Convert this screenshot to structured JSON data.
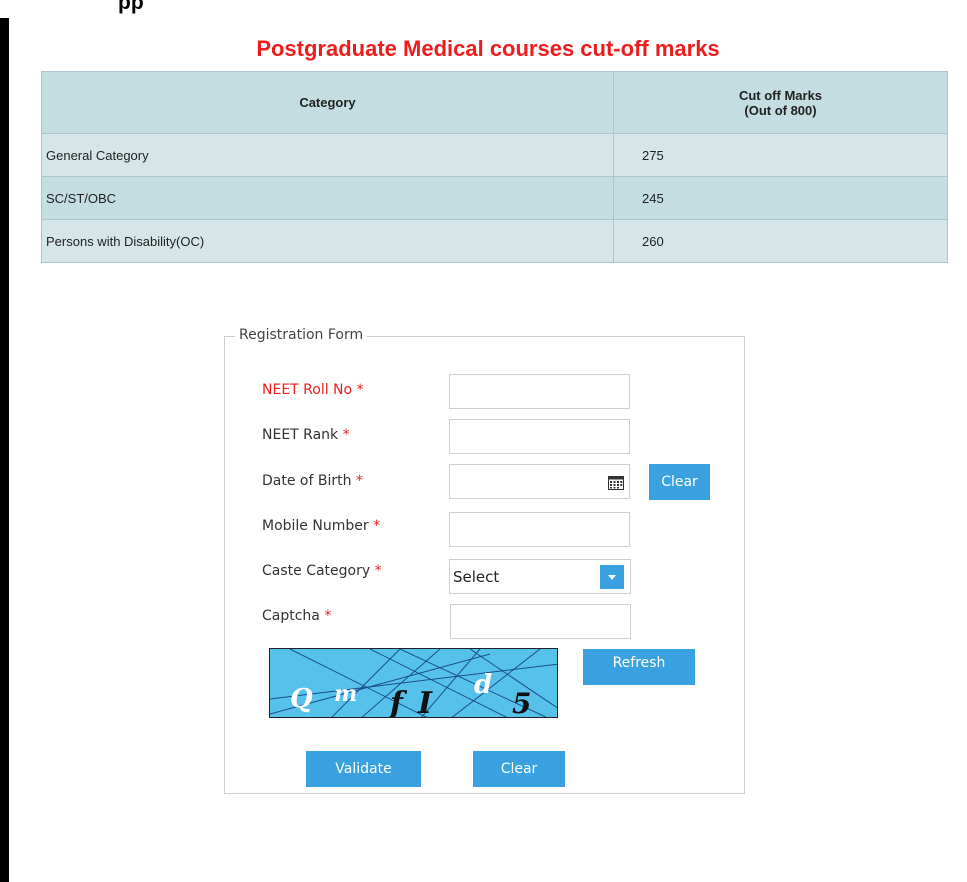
{
  "page_title": "Postgraduate Medical courses cut-off marks",
  "table": {
    "headers": [
      "Category",
      "Cut off Marks\n(Out of 800)"
    ],
    "header_category": "Category",
    "header_marks_line1": "Cut off Marks",
    "header_marks_line2": "(Out of 800)",
    "rows": [
      {
        "category": "General Category",
        "marks": "275"
      },
      {
        "category": "SC/ST/OBC",
        "marks": "245"
      },
      {
        "category": "Persons with Disability(OC)",
        "marks": "260"
      }
    ]
  },
  "form": {
    "legend": "Registration Form",
    "fields": {
      "roll_no": {
        "label": "NEET Roll No",
        "value": ""
      },
      "rank": {
        "label": "NEET Rank",
        "value": ""
      },
      "dob": {
        "label": "Date of Birth",
        "value": ""
      },
      "mobile": {
        "label": "Mobile Number",
        "value": ""
      },
      "caste": {
        "label": "Caste Category",
        "selected": "Select"
      },
      "captcha": {
        "label": "Captcha",
        "value": ""
      }
    },
    "required_mark": "*",
    "dob_clear_label": "Clear",
    "refresh_label": "Refresh",
    "validate_label": "Validate",
    "clear_label": "Clear",
    "captcha_text": "QmfId5"
  },
  "colors": {
    "accent": "#3aa1e0",
    "title_red": "#ee1c1c",
    "table_header": "#c3dde1"
  },
  "icons": {
    "calendar": "calendar-icon",
    "dropdown": "chevron-down-icon"
  }
}
